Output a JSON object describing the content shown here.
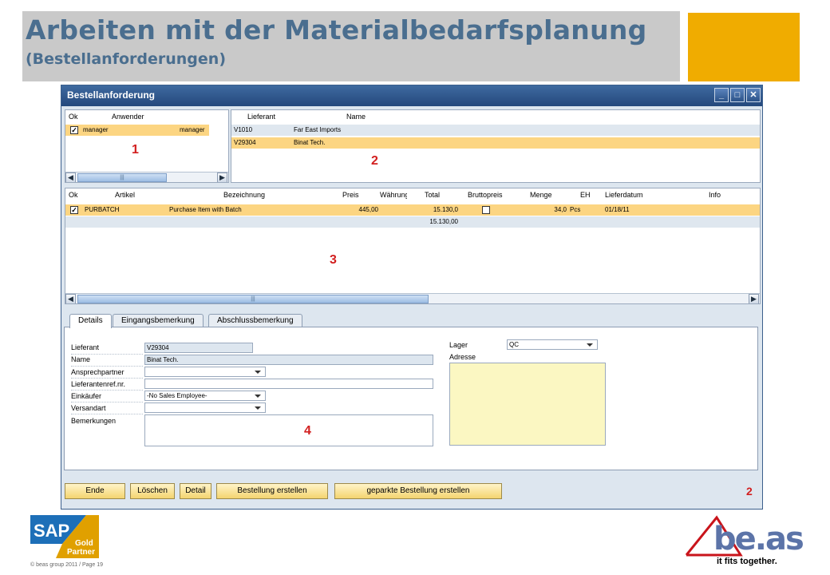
{
  "slide": {
    "title": "Arbeiten mit der Materialbedarfsplanung",
    "subtitle": "(Bestellanforderungen)",
    "copyright": "© beas group 2011 / Page 19"
  },
  "window": {
    "title": "Bestellanforderung",
    "buttons": {
      "minimize": "_",
      "maximize": "□",
      "close": "✕"
    }
  },
  "users_grid": {
    "columns": [
      "Ok",
      "Anwender"
    ],
    "rows": [
      {
        "checked": "✓",
        "user": "manager",
        "name": "manager"
      }
    ]
  },
  "vendor_grid": {
    "columns": [
      "Lieferant",
      "Name"
    ],
    "rows": [
      {
        "code": "V1010",
        "name": "Far East Imports"
      },
      {
        "code": "V29304",
        "name": "Binat Tech."
      }
    ]
  },
  "items_grid": {
    "columns": [
      "Ok",
      "Artikel",
      "Bezeichnung",
      "Preis",
      "Währung",
      "Total",
      "Bruttopreis",
      "Menge",
      "EH",
      "Lieferdatum",
      "Info"
    ],
    "rows": [
      {
        "checked": "✓",
        "artikel": "PURBATCH",
        "bezeichnung": "Purchase Item with Batch",
        "preis": "445,00",
        "total": "15.130,0",
        "menge": "34,0",
        "eh": "Pcs",
        "lieferdatum": "01/18/11"
      }
    ],
    "sum_total": "15.130,00"
  },
  "markers": {
    "m1": "1",
    "m2": "2",
    "m3": "3",
    "m4": "4",
    "m_corner": "2"
  },
  "scroll": {
    "thumb_grip": "|||"
  },
  "tabs": [
    "Details",
    "Eingangsbemerkung",
    "Abschlussbemerkung"
  ],
  "details": {
    "labels": {
      "lieferant": "Lieferant",
      "name": "Name",
      "ansprechpartner": "Ansprechpartner",
      "lieferantenref": "Lieferantenref.nr.",
      "einkaeufer": "Einkäufer",
      "versandart": "Versandart",
      "bemerkungen": "Bemerkungen",
      "lager": "Lager",
      "adresse": "Adresse"
    },
    "values": {
      "lieferant": "V29304",
      "name": "Binat Tech.",
      "ansprechpartner": "",
      "lieferantenref": "",
      "einkaeufer": "-No Sales Employee-",
      "versandart": "",
      "bemerkungen": "",
      "lager": "QC",
      "adresse": ""
    }
  },
  "footer_buttons": [
    "Ende",
    "Löschen",
    "Detail",
    "Bestellung erstellen",
    "geparkte Bestellung erstellen"
  ],
  "logos": {
    "sap": "SAP",
    "sap_badge_line1": "Gold",
    "sap_badge_line2": "Partner",
    "beas": "be.as",
    "beas_tagline": "it fits together."
  },
  "colors": {
    "title_text": "#4a6e8f",
    "title_bar": "#c9c9c9",
    "accent": "#f0ac00",
    "selected_row": "#fcd582",
    "window_frame": "#2b5288",
    "marker_red": "#d21f1f"
  }
}
